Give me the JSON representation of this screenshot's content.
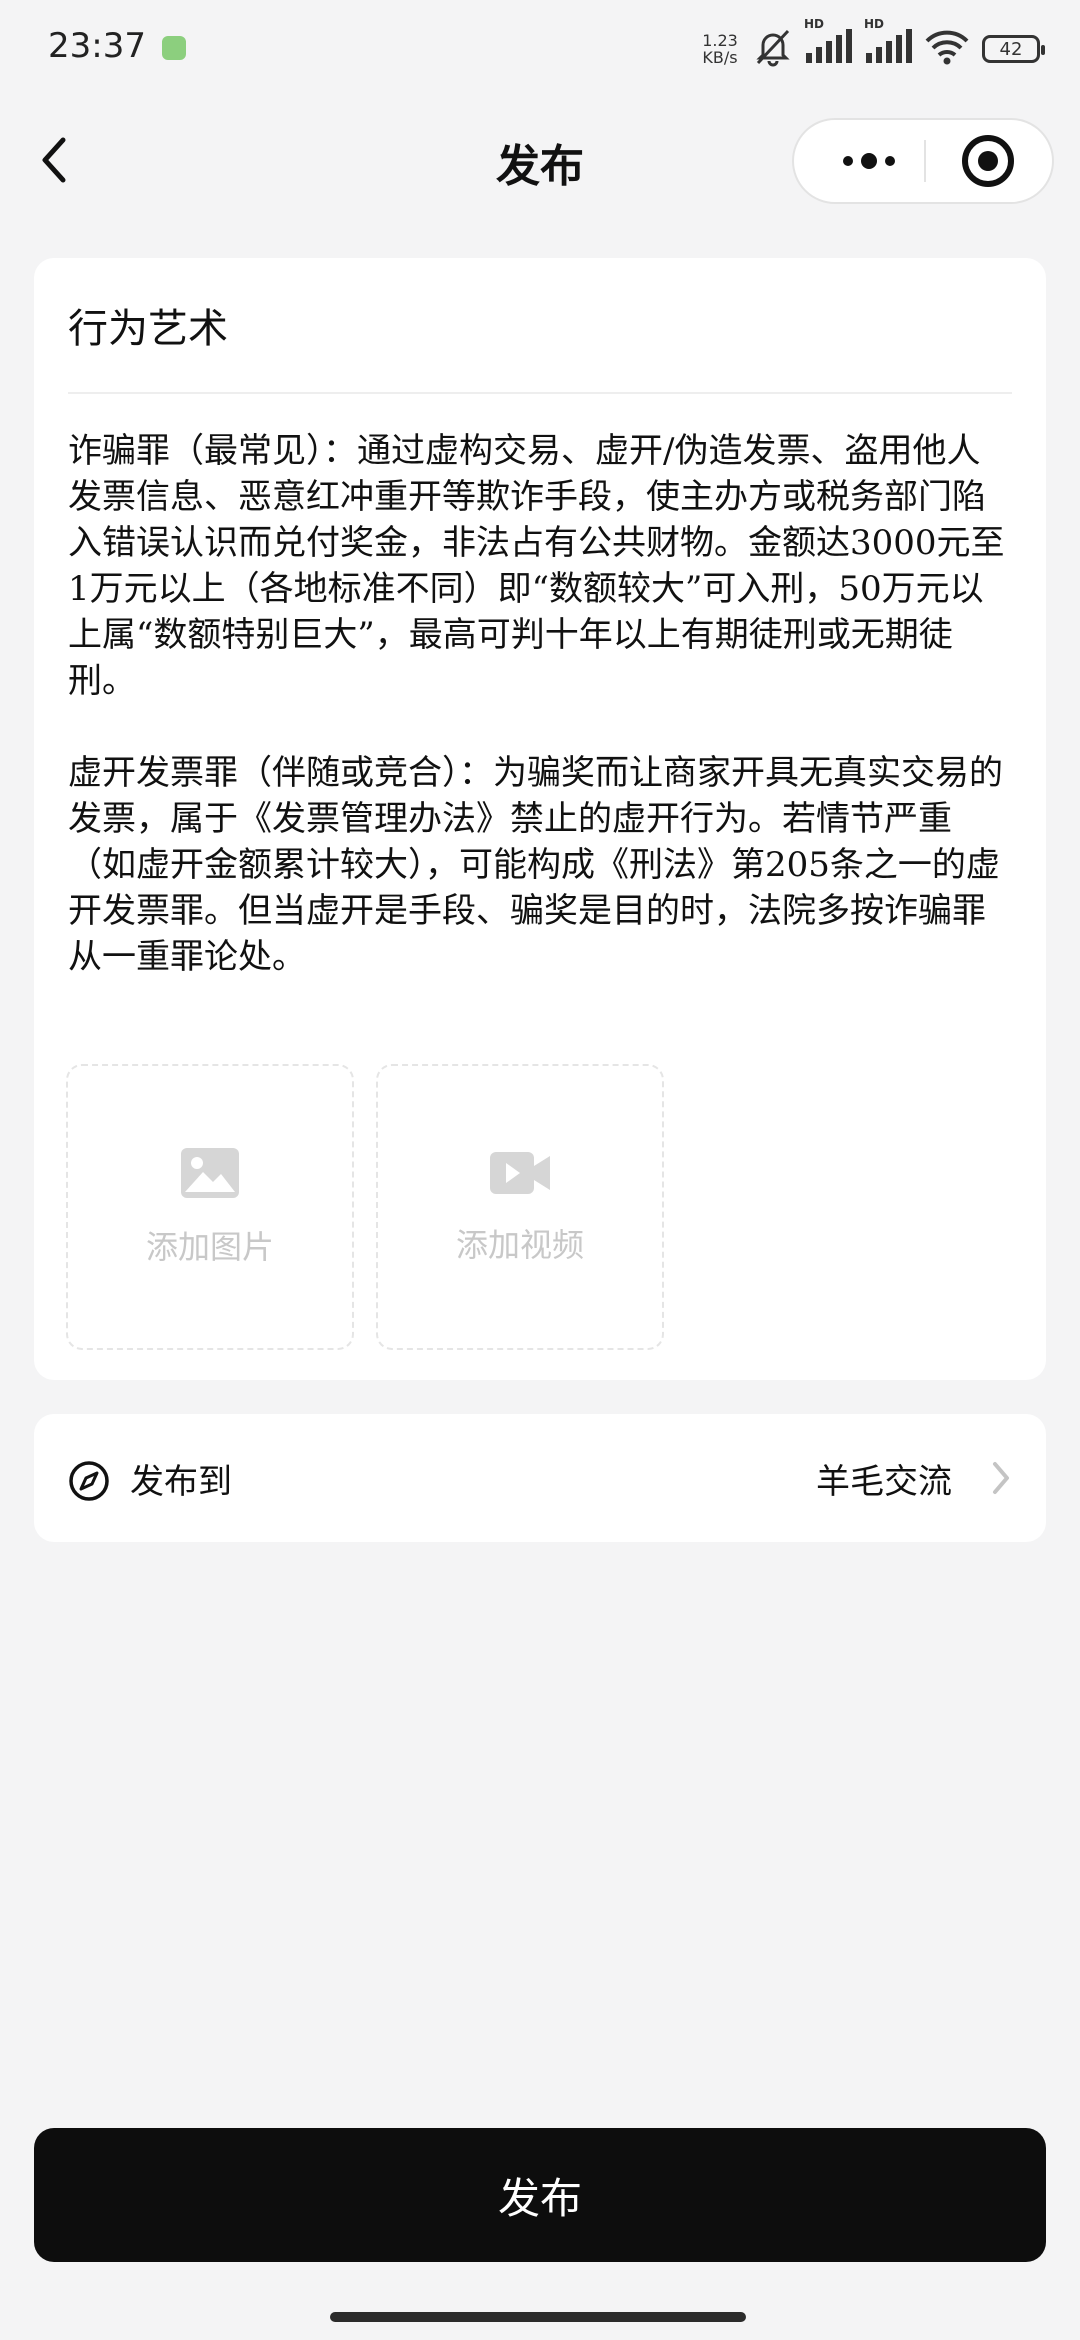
{
  "status_bar": {
    "time": "23:37",
    "speed_value": "1.23",
    "speed_unit": "KB/s",
    "signal_tag_1": "HD",
    "signal_tag_2": "HD",
    "battery": "42",
    "icons": [
      "mute-bell-icon",
      "signal-icon",
      "wifi-icon",
      "battery-icon"
    ]
  },
  "header": {
    "title": "发布",
    "icons": [
      "back-chevron-icon",
      "more-dots-icon",
      "close-target-icon"
    ]
  },
  "editor": {
    "title": "行为艺术",
    "paragraphs": [
      "诈骗罪（最常见）：通过虚构交易、虚开/伪造发票、盗用他人发票信息、恶意红冲重开等欺诈手段，使主办方或税务部门陷入错误认识而兑付奖金，非法占有公共财物。金额达3000元至1万元以上（各地标准不同）即“数额较大”可入刑，50万元以上属“数额特别巨大”，最高可判十年以上有期徒刑或无期徒刑。",
      "虚开发票罪（伴随或竞合）：为骗奖而让商家开具无真实交易的发票，属于《发票管理办法》禁止的虚开行为。若情节严重（如虚开金额累计较大），可能构成《刑法》第205条之一的虚开发票罪。但当虚开是手段、骗奖是目的时，法院多按诈骗罪从一重罪论处。"
    ],
    "add_image_label": "添加图片",
    "add_video_label": "添加视频",
    "icons": [
      "image-icon",
      "video-icon"
    ]
  },
  "publish_to": {
    "label": "发布到",
    "value": "羊毛交流",
    "icons": [
      "compass-icon",
      "chevron-right-icon"
    ]
  },
  "submit": {
    "label": "发布"
  },
  "colors": {
    "background": "#f4f4f5",
    "card": "#ffffff",
    "button": "#0d0d0d",
    "placeholder": "#c8c8c8"
  }
}
